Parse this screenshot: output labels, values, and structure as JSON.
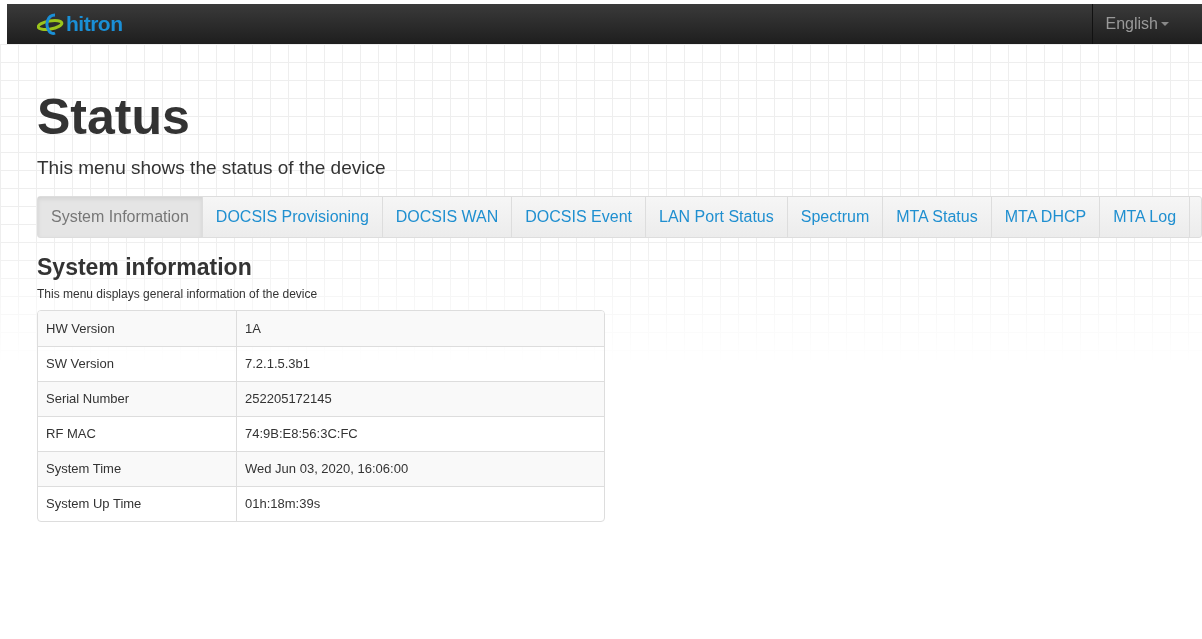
{
  "navbar": {
    "logo": "hitron",
    "language": "English"
  },
  "page": {
    "title": "Status",
    "subtitle": "This menu shows the status of the device"
  },
  "tabs": [
    {
      "label": "System Information",
      "selected": true
    },
    {
      "label": "DOCSIS Provisioning",
      "selected": false
    },
    {
      "label": "DOCSIS WAN",
      "selected": false
    },
    {
      "label": "DOCSIS Event",
      "selected": false
    },
    {
      "label": "LAN Port Status",
      "selected": false
    },
    {
      "label": "Spectrum",
      "selected": false
    },
    {
      "label": "MTA Status",
      "selected": false
    },
    {
      "label": "MTA DHCP",
      "selected": false
    },
    {
      "label": "MTA Log",
      "selected": false
    }
  ],
  "section": {
    "title": "System information",
    "description": "This menu displays general information of the device"
  },
  "table": {
    "rows": [
      {
        "label": "HW Version",
        "value": "1A"
      },
      {
        "label": "SW Version",
        "value": "7.2.1.5.3b1"
      },
      {
        "label": "Serial Number",
        "value": "252205172145"
      },
      {
        "label": "RF MAC",
        "value": "74:9B:E8:56:3C:FC"
      },
      {
        "label": "System Time",
        "value": "Wed Jun 03, 2020, 16:06:00"
      },
      {
        "label": "System Up Time",
        "value": "01h:18m:39s"
      }
    ]
  }
}
